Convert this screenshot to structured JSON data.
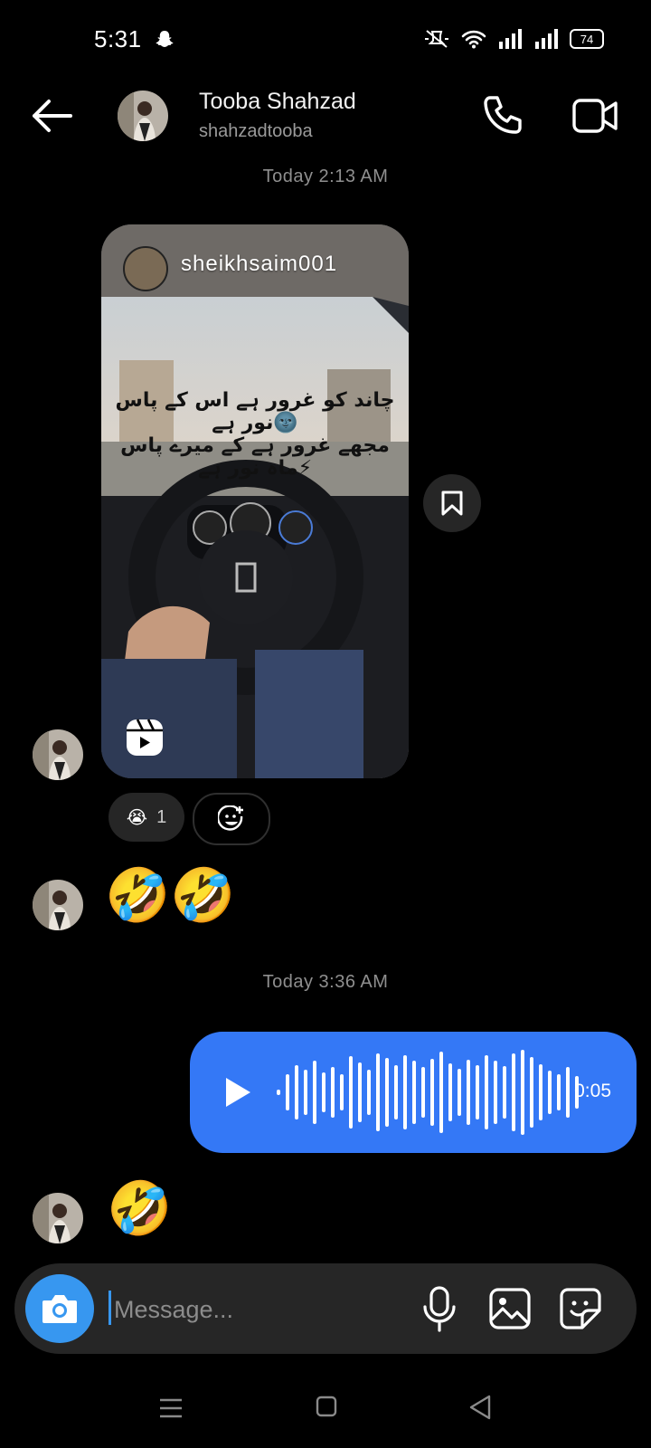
{
  "status_bar": {
    "time": "5:31",
    "battery": "74",
    "icons": [
      "snapchat-icon",
      "mute-icon",
      "wifi-icon",
      "signal-icon",
      "signal-icon",
      "battery-icon"
    ]
  },
  "header": {
    "contact_name": "Tooba Shahzad",
    "contact_username": "shahzadtooba",
    "icons": [
      "back-arrow-icon",
      "phone-icon",
      "video-call-icon"
    ]
  },
  "messages": {
    "timestamp_1": "Today 2:13 AM",
    "reel": {
      "owner": "sheikhsaim001",
      "overlay_line_1": "چاند کو غرور ہے اس کے پاس نور ہے🌚",
      "overlay_line_2": "مجھے غرور ہے کے میرے پاس ماہ نور ہے⚡",
      "icons": [
        "reels-icon",
        "save-bookmark-icon"
      ]
    },
    "reaction": {
      "emoji": "😭",
      "count": "1"
    },
    "emoji_message_1": "🤣🤣",
    "timestamp_2": "Today 3:36 AM",
    "voice_message": {
      "duration": "0:05",
      "icon": "play-icon"
    },
    "emoji_message_2": "🤣"
  },
  "composer": {
    "placeholder": "Message...",
    "icons": [
      "camera-icon",
      "microphone-icon",
      "gallery-icon",
      "sticker-icon"
    ]
  },
  "nav_bar": {
    "icons": [
      "menu-icon",
      "home-icon",
      "back-icon"
    ]
  },
  "colors": {
    "accent_blue": "#3797f0",
    "voice_bubble": "#3478f6",
    "bubble_dark": "#262626",
    "background": "#000000"
  }
}
